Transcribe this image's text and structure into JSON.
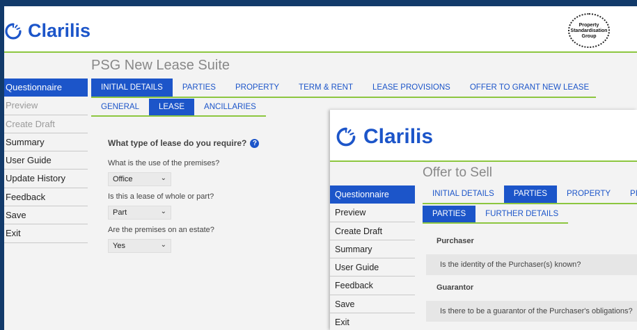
{
  "window1": {
    "brand": "Clarilis",
    "partner_logo": [
      "Property",
      "Standardisation",
      "Group"
    ],
    "suite_title": "PSG New Lease Suite",
    "sidebar": [
      {
        "label": "Questionnaire",
        "state": "active"
      },
      {
        "label": "Preview",
        "state": "disabled"
      },
      {
        "label": "Create Draft",
        "state": "disabled"
      },
      {
        "label": "Summary",
        "state": "normal"
      },
      {
        "label": "User Guide",
        "state": "normal"
      },
      {
        "label": "Update History",
        "state": "normal"
      },
      {
        "label": "Feedback",
        "state": "normal"
      },
      {
        "label": "Save",
        "state": "normal"
      },
      {
        "label": "Exit",
        "state": "normal"
      }
    ],
    "tabs": [
      "INITIAL DETAILS",
      "PARTIES",
      "PROPERTY",
      "TERM & RENT",
      "LEASE PROVISIONS",
      "OFFER TO GRANT NEW LEASE"
    ],
    "active_tab": "INITIAL DETAILS",
    "subtabs": [
      "GENERAL",
      "LEASE",
      "ANCILLARIES"
    ],
    "active_subtab": "LEASE",
    "question_heading": "What type of lease do you require?",
    "questions": [
      {
        "label": "What is the use of the premises?",
        "value": "Office"
      },
      {
        "label": "Is this a lease of whole or part?",
        "value": "Part"
      },
      {
        "label": "Are the premises on an estate?",
        "value": "Yes"
      }
    ]
  },
  "window2": {
    "brand": "Clarilis",
    "suite_title": "Offer to Sell",
    "sidebar": [
      {
        "label": "Questionnaire",
        "state": "active"
      },
      {
        "label": "Preview",
        "state": "normal"
      },
      {
        "label": "Create Draft",
        "state": "normal"
      },
      {
        "label": "Summary",
        "state": "normal"
      },
      {
        "label": "User Guide",
        "state": "normal"
      },
      {
        "label": "Feedback",
        "state": "normal"
      },
      {
        "label": "Save",
        "state": "normal"
      },
      {
        "label": "Exit",
        "state": "normal"
      }
    ],
    "tabs": [
      "INITIAL DETAILS",
      "PARTIES",
      "PROPERTY",
      "PI"
    ],
    "active_tab": "PARTIES",
    "subtabs": [
      "PARTIES",
      "FURTHER DETAILS"
    ],
    "active_subtab": "PARTIES",
    "sections": [
      {
        "label": "Purchaser",
        "question": "Is the identity of the Purchaser(s) known?"
      },
      {
        "label": "Guarantor",
        "question": "Is there to be a guarantor of the Purchaser's obligations?"
      }
    ]
  },
  "colors": {
    "accent": "#1c55c9",
    "divider": "#8cc63f",
    "background": "#123a6a"
  }
}
